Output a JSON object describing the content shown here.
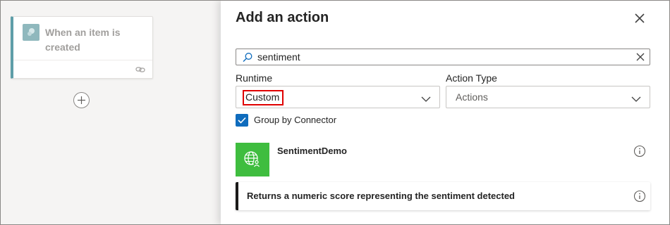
{
  "canvas": {
    "trigger": {
      "title": "When an item is created"
    }
  },
  "panel": {
    "title": "Add an action",
    "search": {
      "value": "sentiment",
      "placeholder": "Search"
    },
    "runtime": {
      "label": "Runtime",
      "value": "Custom"
    },
    "action_type": {
      "label": "Action Type",
      "value": "Actions"
    },
    "group_by_connector": {
      "label": "Group by Connector",
      "checked": true
    },
    "connector": {
      "name": "SentimentDemo",
      "color": "#3fbd3f"
    },
    "actions": [
      {
        "label": "Returns a numeric score representing the sentiment detected"
      }
    ]
  },
  "colors": {
    "accent": "#0f6cbd",
    "highlight": "#e00000"
  }
}
